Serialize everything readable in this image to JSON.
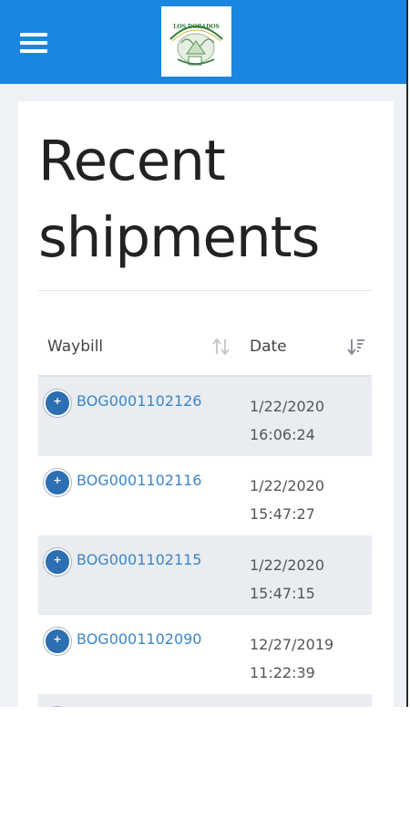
{
  "header": {
    "menu_icon": "hamburger-menu-icon",
    "logo_text": "LOS DORADOS",
    "brand_color": "#1b86e2"
  },
  "page": {
    "title": "Recent shipments"
  },
  "table": {
    "columns": [
      {
        "label": "Waybill",
        "sort_icon": "sort-neutral-icon"
      },
      {
        "label": "Date",
        "sort_icon": "sort-descending-icon"
      }
    ],
    "rows": [
      {
        "waybill": "BOG0001102126",
        "date": "1/22/2020",
        "time": "16:06:24"
      },
      {
        "waybill": "BOG0001102116",
        "date": "1/22/2020",
        "time": "15:47:27"
      },
      {
        "waybill": "BOG0001102115",
        "date": "1/22/2020",
        "time": "15:47:15"
      },
      {
        "waybill": "BOG0001102090",
        "date": "12/27/2019",
        "time": "11:22:39"
      }
    ]
  }
}
